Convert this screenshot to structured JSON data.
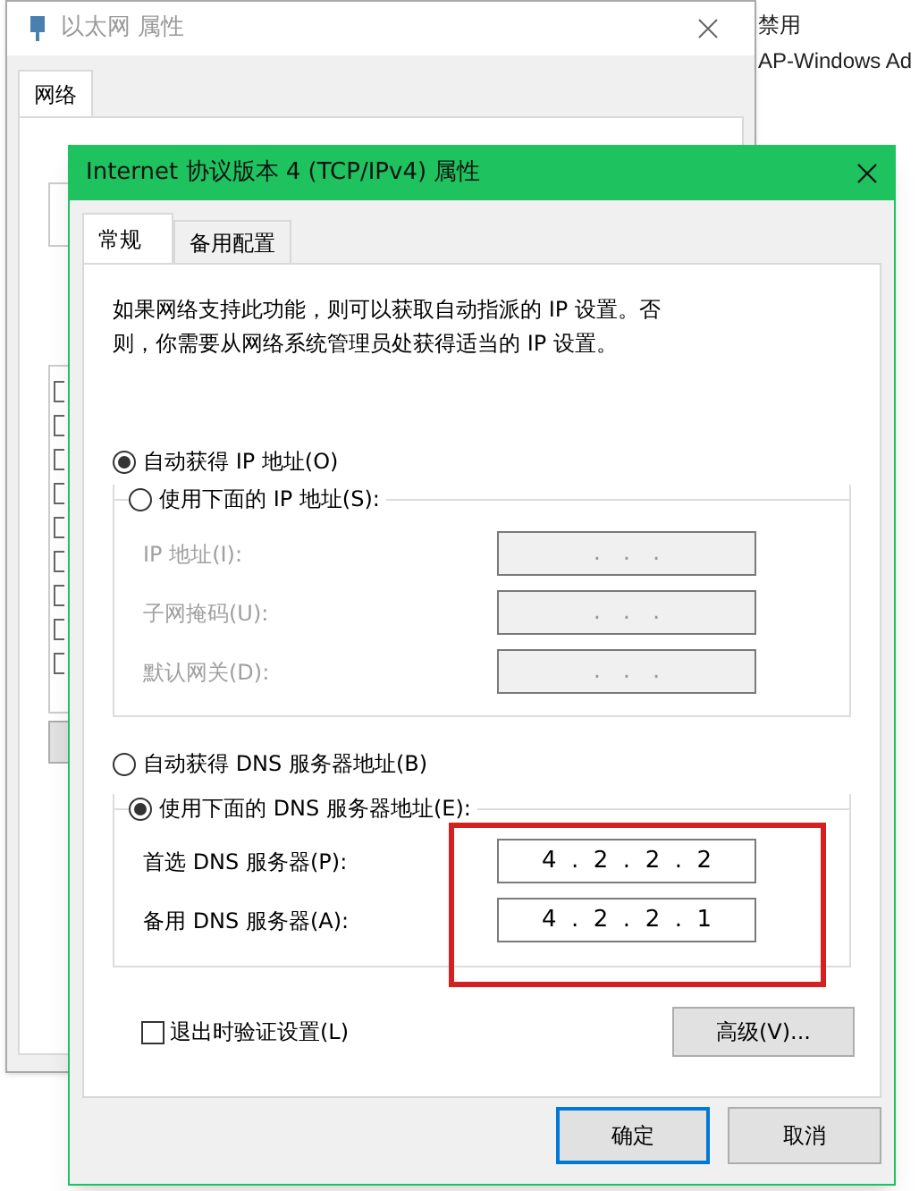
{
  "background_window": {
    "title": "以太网 属性",
    "tab": "网络"
  },
  "desktop_texts": [
    "禁用",
    "AP-Windows Ad"
  ],
  "dialog": {
    "title": "Internet 协议版本 4 (TCP/IPv4) 属性",
    "tabs": [
      {
        "label": "常规",
        "selected": true
      },
      {
        "label": "备用配置",
        "selected": false
      }
    ],
    "description": "如果网络支持此功能，则可以获取自动指派的 IP 设置。否则，你需要从网络系统管理员处获得适当的 IP 设置。",
    "ip_auto": {
      "label": "自动获得 IP 地址(O)",
      "selected": true
    },
    "ip_manual": {
      "label": "使用下面的 IP 地址(S):",
      "selected": false
    },
    "ip_fields": [
      {
        "label": "IP 地址(I):",
        "value": ".   .   .",
        "disabled": true
      },
      {
        "label": "子网掩码(U):",
        "value": ".   .   .",
        "disabled": true
      },
      {
        "label": "默认网关(D):",
        "value": ".   .   .",
        "disabled": true
      }
    ],
    "dns_auto": {
      "label": "自动获得 DNS 服务器地址(B)",
      "selected": false
    },
    "dns_manual": {
      "label": "使用下面的 DNS 服务器地址(E):",
      "selected": true
    },
    "dns_fields": [
      {
        "label": "首选 DNS 服务器(P):",
        "value": "4  .  2  .  2  .  2",
        "disabled": false
      },
      {
        "label": "备用 DNS 服务器(A):",
        "value": "4  .  2  .  2  .  1",
        "disabled": false
      }
    ],
    "validate": {
      "label": "退出时验证设置(L)",
      "checked": false
    },
    "advanced_button": "高级(V)...",
    "buttons": [
      {
        "label": "确定",
        "default": true
      },
      {
        "label": "取消",
        "default": false
      }
    ]
  }
}
